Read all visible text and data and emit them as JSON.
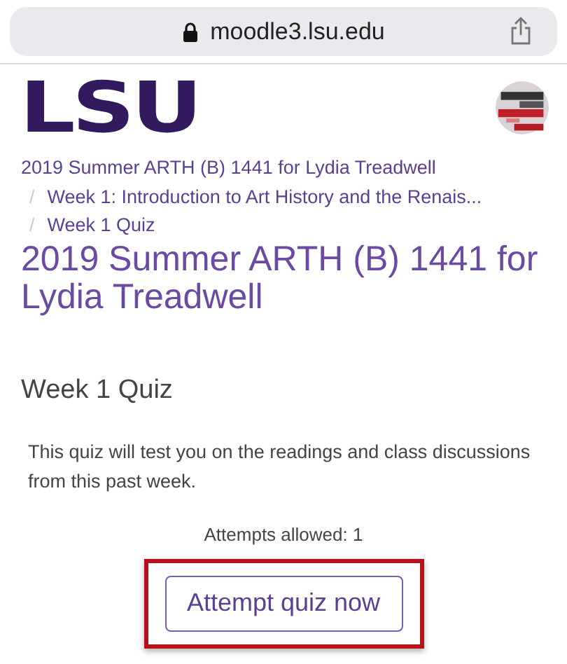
{
  "address_bar": {
    "url": "moodle3.lsu.edu",
    "secure": true
  },
  "header": {
    "logo": "LSU"
  },
  "breadcrumbs": [
    {
      "label": "2019 Summer ARTH (B) 1441 for Lydia Treadwell"
    },
    {
      "separator": "/",
      "label": "Week 1: Introduction to Art History and the Renais..."
    },
    {
      "separator": "/",
      "label": "Week 1 Quiz"
    }
  ],
  "page_title": "2019 Summer ARTH (B) 1441 for Lydia Treadwell",
  "quiz": {
    "title": "Week 1 Quiz",
    "description": "This quiz will test you on the readings and class discussions from this past week.",
    "attempts": "Attempts allowed: 1",
    "button": "Attempt quiz now",
    "button_highlighted": true
  }
}
